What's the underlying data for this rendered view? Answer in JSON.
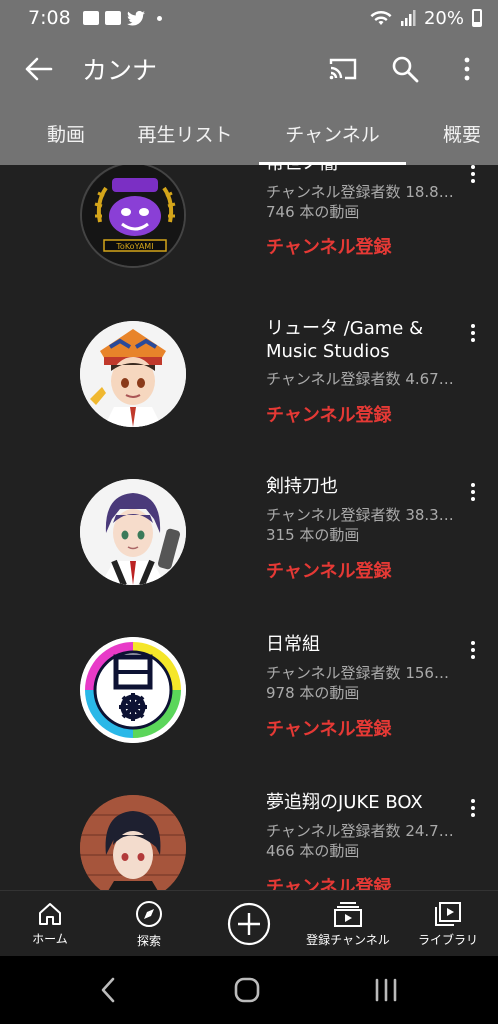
{
  "status": {
    "time": "7:08",
    "battery": "20%"
  },
  "appbar": {
    "title": "カンナ"
  },
  "tabs": [
    {
      "label": "動画"
    },
    {
      "label": "再生リスト"
    },
    {
      "label": "チャンネル"
    },
    {
      "label": "概要"
    }
  ],
  "channels": [
    {
      "name": "常世ノ闇",
      "subs": "チャンネル登録者数 18.8…",
      "videos": "746 本の動画",
      "action": "チャンネル登録",
      "avatar_text": "ToKoYAMI"
    },
    {
      "name": "リュータ /Game & Music Studios",
      "subs": "チャンネル登録者数 4.67…",
      "videos": "",
      "action": "チャンネル登録"
    },
    {
      "name": "剣持刀也",
      "subs": "チャンネル登録者数 38.3…",
      "videos": "315 本の動画",
      "action": "チャンネル登録"
    },
    {
      "name": "日常組",
      "subs": "チャンネル登録者数 156…",
      "videos": "978 本の動画",
      "action": "チャンネル登録"
    },
    {
      "name": "夢追翔のJUKE BOX",
      "subs": "チャンネル登録者数 24.7…",
      "videos": "466 本の動画",
      "action": "チャンネル登録"
    }
  ],
  "bottom_nav": [
    {
      "label": "ホーム",
      "icon": "home-icon"
    },
    {
      "label": "探索",
      "icon": "compass-icon"
    },
    {
      "label": "",
      "icon": "create-plus-icon"
    },
    {
      "label": "登録チャンネル",
      "icon": "subscriptions-icon"
    },
    {
      "label": "ライブラリ",
      "icon": "library-icon"
    }
  ]
}
